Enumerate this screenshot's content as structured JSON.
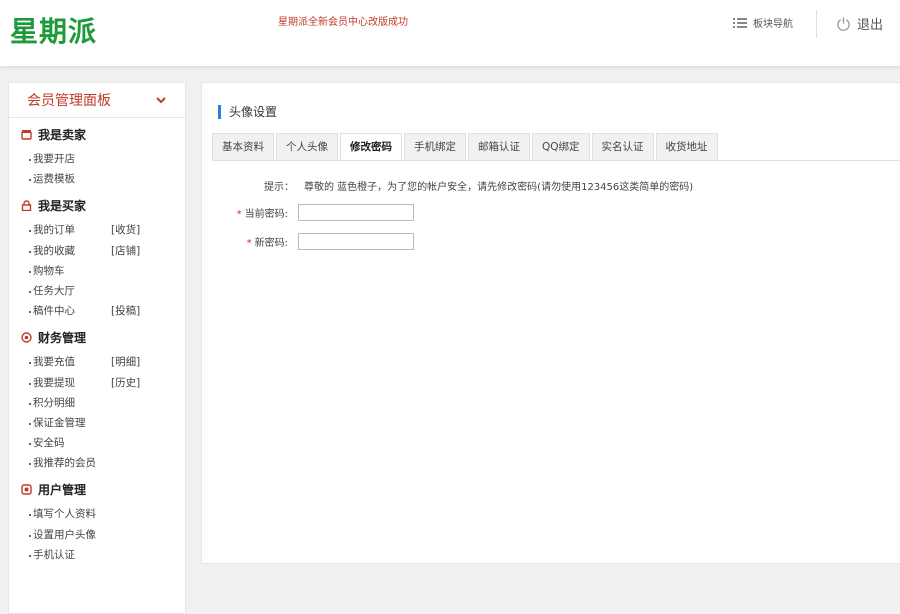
{
  "header": {
    "logo": "星期派",
    "notice": "星期派全新会员中心改版成功",
    "nav_label": "板块导航",
    "logout_label": "退出"
  },
  "sidebar": {
    "title": "会员管理面板",
    "groups": [
      {
        "title": "我是卖家",
        "icon": "shop-icon",
        "items": [
          {
            "label": "我要开店",
            "extra": ""
          },
          {
            "label": "运费模板",
            "extra": ""
          }
        ]
      },
      {
        "title": "我是买家",
        "icon": "lock-icon",
        "items": [
          {
            "label": "我的订单",
            "extra": "[收货]"
          },
          {
            "label": "我的收藏",
            "extra": "[店铺]"
          },
          {
            "label": "购物车",
            "extra": ""
          },
          {
            "label": "任务大厅",
            "extra": ""
          },
          {
            "label": "稿件中心",
            "extra": "[投稿]"
          }
        ]
      },
      {
        "title": "财务管理",
        "icon": "finance-icon",
        "items": [
          {
            "label": "我要充值",
            "extra": "[明细]"
          },
          {
            "label": "我要提现",
            "extra": "[历史]"
          },
          {
            "label": "积分明细",
            "extra": ""
          },
          {
            "label": "保证金管理",
            "extra": ""
          },
          {
            "label": "安全码",
            "extra": ""
          },
          {
            "label": "我推荐的会员",
            "extra": ""
          }
        ]
      },
      {
        "title": "用户管理",
        "icon": "user-icon",
        "items": [
          {
            "label": "填写个人资料",
            "extra": ""
          },
          {
            "label": "设置用户头像",
            "extra": ""
          },
          {
            "label": "手机认证",
            "extra": ""
          }
        ]
      }
    ]
  },
  "main": {
    "section_title": "头像设置",
    "tabs": [
      "基本资料",
      "个人头像",
      "修改密码",
      "手机绑定",
      "邮箱认证",
      "QQ绑定",
      "实名认证",
      "收货地址"
    ],
    "active_tab": 2,
    "hint_label": "提示：",
    "hint_text": "尊敬的 蓝色橙子，为了您的帐户安全，请先修改密码(请勿使用123456这类简单的密码)",
    "fields": [
      {
        "label": "当前密码:",
        "value": ""
      },
      {
        "label": "新密码:",
        "value": ""
      }
    ],
    "required_mark": "*"
  },
  "colors": {
    "logo": "#1f9a3b",
    "notice": "#c0392b",
    "sidebar_title": "#c0392b",
    "accent_bar": "#2c7be5",
    "required": "#c0392b"
  }
}
